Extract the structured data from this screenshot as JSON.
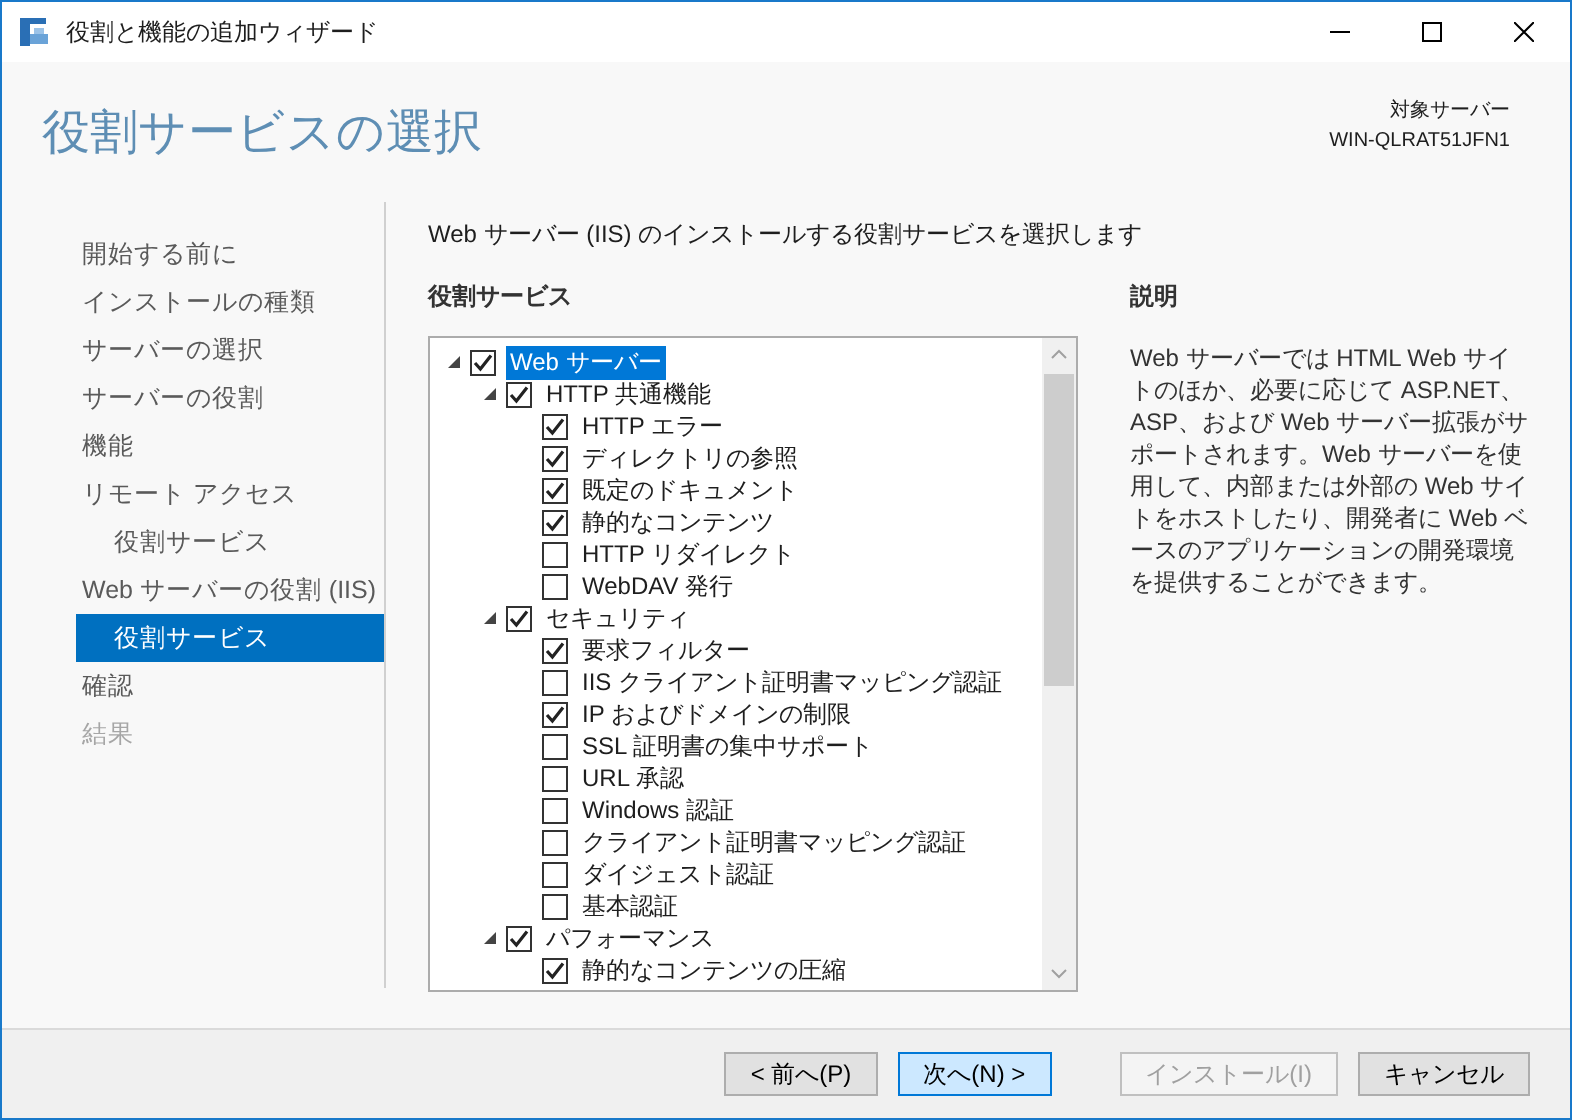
{
  "window": {
    "title": "役割と機能の追加ウィザード"
  },
  "header": {
    "title": "役割サービスの選択",
    "target_label": "対象サーバー",
    "target_server": "WIN-QLRAT51JFN1"
  },
  "nav": [
    {
      "label": "開始する前に",
      "selected": false,
      "disabled": false
    },
    {
      "label": "インストールの種類",
      "selected": false,
      "disabled": false
    },
    {
      "label": "サーバーの選択",
      "selected": false,
      "disabled": false
    },
    {
      "label": "サーバーの役割",
      "selected": false,
      "disabled": false
    },
    {
      "label": "機能",
      "selected": false,
      "disabled": false
    },
    {
      "label": "リモート アクセス",
      "selected": false,
      "disabled": false,
      "children": [
        {
          "label": "役割サービス",
          "selected": false,
          "disabled": false
        }
      ]
    },
    {
      "label": "Web サーバーの役割 (IIS)",
      "selected": false,
      "disabled": false,
      "children": [
        {
          "label": "役割サービス",
          "selected": true,
          "disabled": false
        }
      ]
    },
    {
      "label": "確認",
      "selected": false,
      "disabled": false
    },
    {
      "label": "結果",
      "selected": false,
      "disabled": true
    }
  ],
  "instruction": "Web サーバー (IIS) のインストールする役割サービスを選択します",
  "services": {
    "heading": "役割サービス",
    "tree": [
      {
        "label": "Web サーバー",
        "checked": true,
        "selected": true,
        "expanded": true,
        "children": [
          {
            "label": "HTTP 共通機能",
            "checked": true,
            "selected": false,
            "expanded": true,
            "children": [
              {
                "label": "HTTP エラー",
                "checked": true,
                "selected": false
              },
              {
                "label": "ディレクトリの参照",
                "checked": true,
                "selected": false
              },
              {
                "label": "既定のドキュメント",
                "checked": true,
                "selected": false
              },
              {
                "label": "静的なコンテンツ",
                "checked": true,
                "selected": false
              },
              {
                "label": "HTTP リダイレクト",
                "checked": false,
                "selected": false
              },
              {
                "label": "WebDAV 発行",
                "checked": false,
                "selected": false
              }
            ]
          },
          {
            "label": "セキュリティ",
            "checked": true,
            "selected": false,
            "expanded": true,
            "children": [
              {
                "label": "要求フィルター",
                "checked": true,
                "selected": false
              },
              {
                "label": "IIS クライアント証明書マッピング認証",
                "checked": false,
                "selected": false
              },
              {
                "label": "IP およびドメインの制限",
                "checked": true,
                "selected": false
              },
              {
                "label": "SSL 証明書の集中サポート",
                "checked": false,
                "selected": false
              },
              {
                "label": "URL 承認",
                "checked": false,
                "selected": false
              },
              {
                "label": "Windows 認証",
                "checked": false,
                "selected": false
              },
              {
                "label": "クライアント証明書マッピング認証",
                "checked": false,
                "selected": false
              },
              {
                "label": "ダイジェスト認証",
                "checked": false,
                "selected": false
              },
              {
                "label": "基本認証",
                "checked": false,
                "selected": false
              }
            ]
          },
          {
            "label": "パフォーマンス",
            "checked": true,
            "selected": false,
            "expanded": true,
            "children": [
              {
                "label": "静的なコンテンツの圧縮",
                "checked": true,
                "selected": false
              }
            ]
          }
        ]
      }
    ]
  },
  "description": {
    "heading": "説明",
    "text": "Web サーバーでは HTML Web サイトのほか、必要に応じて ASP.NET、ASP、および Web サーバー拡張がサポートされます。Web サーバーを使用して、内部または外部の Web サイトをホストしたり、開発者に Web ベースのアプリケーションの開発環境を提供することができます。"
  },
  "buttons": [
    {
      "label": "< 前へ(P)",
      "disabled": false,
      "highlighted": false
    },
    {
      "label": "次へ(N) >",
      "disabled": false,
      "highlighted": true
    },
    {
      "label": "インストール(I)",
      "disabled": true,
      "highlighted": false
    },
    {
      "label": "キャンセル",
      "disabled": false,
      "highlighted": false
    }
  ]
}
